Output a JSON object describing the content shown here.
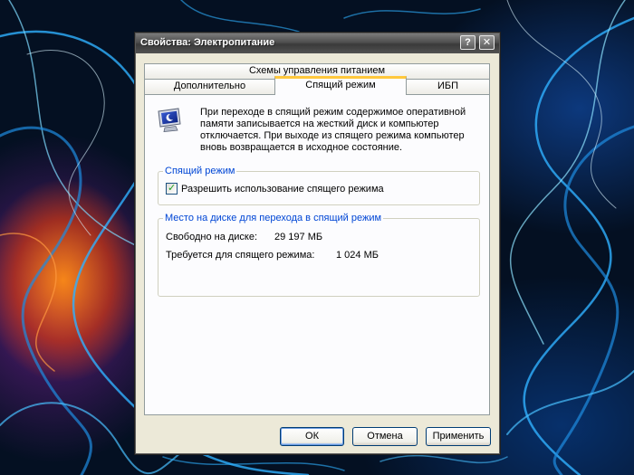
{
  "window": {
    "title": "Свойства: Электропитание",
    "help_glyph": "?",
    "close_glyph": "✕"
  },
  "tabs": {
    "row_top": [
      "Схемы управления питанием"
    ],
    "row_bottom": [
      "Дополнительно",
      "Спящий режим",
      "ИБП"
    ],
    "active": "Спящий режим"
  },
  "hibernate": {
    "description": "При переходе в спящий режим содержимое оперативной памяти записывается на жесткий диск и компьютер отключается. При выходе из спящего режима компьютер вновь возвращается в исходное состояние.",
    "group_title": "Спящий режим",
    "enable_label": "Разрешить использование спящего режима",
    "enable_checked": true,
    "check_glyph": "✓"
  },
  "disk": {
    "group_title": "Место на диске для перехода в спящий режим",
    "free_label": "Свободно на диске:",
    "free_value": "29 197 МБ",
    "required_label": "Требуется для спящего режима:",
    "required_value": "1 024 МБ"
  },
  "buttons": {
    "ok": "ОК",
    "cancel": "Отмена",
    "apply": "Применить"
  },
  "colors": {
    "accent_tab": "#ffc83c",
    "group_title": "#0046d5"
  }
}
